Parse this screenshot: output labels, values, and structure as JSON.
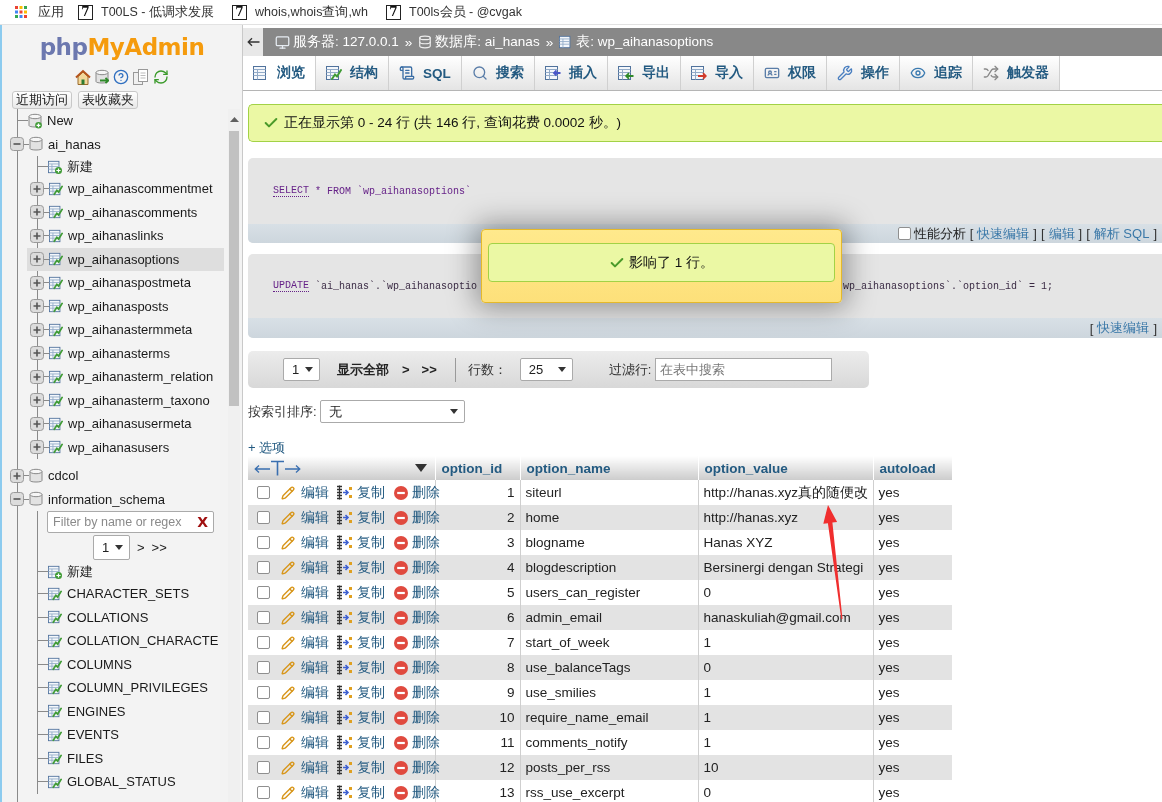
{
  "bookmarks_bar": {
    "apps_label": "应用",
    "bookmarks": [
      {
        "favicon": "7",
        "label": "T00LS - 低调求发展"
      },
      {
        "favicon": "7",
        "label": "whois,whois查询,wh"
      },
      {
        "favicon": "7",
        "label": "T00ls会员 - @cvgak"
      }
    ]
  },
  "sidebar": {
    "logo": {
      "part_1": "php",
      "part_2": "MyAdmin"
    },
    "buttons": [
      "近期访问",
      "表收藏夹"
    ],
    "tree": [
      {
        "kind": "new",
        "label": "New",
        "selected": false
      },
      {
        "kind": "database",
        "label": "ai_hanas",
        "expanded": true,
        "selected": false,
        "children": [
          {
            "kind": "new",
            "label": "新建",
            "selected": false
          },
          {
            "kind": "table",
            "label": "wp_aihanascommentmet",
            "expanded": false,
            "selected": false
          },
          {
            "kind": "table",
            "label": "wp_aihanascomments",
            "expanded": false,
            "selected": false
          },
          {
            "kind": "table",
            "label": "wp_aihanaslinks",
            "expanded": false,
            "selected": false
          },
          {
            "kind": "table",
            "label": "wp_aihanasoptions",
            "expanded": false,
            "selected": true
          },
          {
            "kind": "table",
            "label": "wp_aihanaspostmeta",
            "expanded": false,
            "selected": false
          },
          {
            "kind": "table",
            "label": "wp_aihanasposts",
            "expanded": false,
            "selected": false
          },
          {
            "kind": "table",
            "label": "wp_aihanastermmeta",
            "expanded": false,
            "selected": false
          },
          {
            "kind": "table",
            "label": "wp_aihanasterms",
            "expanded": false,
            "selected": false
          },
          {
            "kind": "table",
            "label": "wp_aihanasterm_relation",
            "expanded": false,
            "selected": false
          },
          {
            "kind": "table",
            "label": "wp_aihanasterm_taxono",
            "expanded": false,
            "selected": false
          },
          {
            "kind": "table",
            "label": "wp_aihanasusermeta",
            "expanded": false,
            "selected": false
          },
          {
            "kind": "table",
            "label": "wp_aihanasusers",
            "expanded": false,
            "selected": false
          }
        ]
      },
      {
        "kind": "database",
        "label": "cdcol",
        "expanded": false,
        "selected": false
      },
      {
        "kind": "database",
        "label": "information_schema",
        "expanded": true,
        "selected": false,
        "filter": {
          "placeholder": "Filter by name or regex",
          "clear_label": "X"
        },
        "pager": {
          "page": "1",
          "links": [
            ">",
            ">>"
          ]
        },
        "children": [
          {
            "kind": "new",
            "label": "新建",
            "selected": false
          },
          {
            "kind": "table",
            "label": "CHARACTER_SETS",
            "selected": false
          },
          {
            "kind": "table",
            "label": "COLLATIONS",
            "selected": false
          },
          {
            "kind": "table",
            "label": "COLLATION_CHARACTE",
            "selected": false
          },
          {
            "kind": "table",
            "label": "COLUMNS",
            "selected": false
          },
          {
            "kind": "table",
            "label": "COLUMN_PRIVILEGES",
            "selected": false
          },
          {
            "kind": "table",
            "label": "ENGINES",
            "selected": false
          },
          {
            "kind": "table",
            "label": "EVENTS",
            "selected": false
          },
          {
            "kind": "table",
            "label": "FILES",
            "selected": false
          },
          {
            "kind": "table",
            "label": "GLOBAL_STATUS",
            "selected": false
          }
        ]
      }
    ]
  },
  "breadcrumb": [
    {
      "label": "服务器: 127.0.0.1",
      "separator": "»"
    },
    {
      "label": "数据库: ai_hanas",
      "separator": "»"
    },
    {
      "label": "表: wp_aihanasoptions"
    }
  ],
  "tabs": [
    {
      "label": "浏览",
      "selected": true
    },
    {
      "label": "结构",
      "selected": false
    },
    {
      "label": "SQL",
      "selected": false
    },
    {
      "label": "搜索",
      "selected": false
    },
    {
      "label": "插入",
      "selected": false
    },
    {
      "label": "导出",
      "selected": false
    },
    {
      "label": "导入",
      "selected": false
    },
    {
      "label": "权限",
      "selected": false
    },
    {
      "label": "操作",
      "selected": false
    },
    {
      "label": "追踪",
      "selected": false
    },
    {
      "label": "触发器",
      "selected": false
    }
  ],
  "success_message": "正在显示第 0 - 24 行 (共 146 行, 查询花费 0.0002 秒。)",
  "queries": [
    {
      "keyword": "SELECT",
      "text": "* FROM `wp_aihanasoptions`",
      "profiling": {
        "label": "性能分析",
        "checked": false
      },
      "links": [
        {
          "open": "[",
          "label": "快速编辑",
          "close": "]"
        },
        {
          "open": "[",
          "label": "编辑",
          "close": "]"
        },
        {
          "open": "[",
          "label": "解析 SQL",
          "close": "]"
        }
      ]
    },
    {
      "keyword": "UPDATE",
      "text": "`ai_hanas`.`wp_aihanasoptio",
      "text_after_popup": "wp_aihanasoptions`.`option_id` = 1;",
      "links": [
        {
          "open": "[",
          "label": "快速编辑",
          "close": "]"
        }
      ]
    }
  ],
  "popup": {
    "message": "影响了 1 行。"
  },
  "pager": {
    "page": "1",
    "show_all": "显示全部",
    "next": ">",
    "last": ">>",
    "rows_label": "行数：",
    "rows_value": "25",
    "filter_label": "过滤行:",
    "filter_placeholder": "在表中搜索"
  },
  "sort": {
    "label": "按索引排序:",
    "value": "无"
  },
  "options_link": "+ 选项",
  "table": {
    "columns": [
      "option_id",
      "option_name",
      "option_value",
      "autoload"
    ],
    "rows": [
      {
        "checked": false,
        "actions": [
          "编辑",
          "复制",
          "删除"
        ],
        "cells": [
          "1",
          "siteurl",
          "http://hanas.xyz真的随便改",
          "yes"
        ]
      },
      {
        "checked": false,
        "actions": [
          "编辑",
          "复制",
          "删除"
        ],
        "cells": [
          "2",
          "home",
          "http://hanas.xyz",
          "yes"
        ]
      },
      {
        "checked": false,
        "actions": [
          "编辑",
          "复制",
          "删除"
        ],
        "cells": [
          "3",
          "blogname",
          "Hanas XYZ",
          "yes"
        ]
      },
      {
        "checked": false,
        "actions": [
          "编辑",
          "复制",
          "删除"
        ],
        "cells": [
          "4",
          "blogdescription",
          "Bersinergi dengan Strategi",
          "yes"
        ]
      },
      {
        "checked": false,
        "actions": [
          "编辑",
          "复制",
          "删除"
        ],
        "cells": [
          "5",
          "users_can_register",
          "0",
          "yes"
        ]
      },
      {
        "checked": false,
        "actions": [
          "编辑",
          "复制",
          "删除"
        ],
        "cells": [
          "6",
          "admin_email",
          "hanaskuliah@gmail.com",
          "yes"
        ]
      },
      {
        "checked": false,
        "actions": [
          "编辑",
          "复制",
          "删除"
        ],
        "cells": [
          "7",
          "start_of_week",
          "1",
          "yes"
        ]
      },
      {
        "checked": false,
        "actions": [
          "编辑",
          "复制",
          "删除"
        ],
        "cells": [
          "8",
          "use_balanceTags",
          "0",
          "yes"
        ]
      },
      {
        "checked": false,
        "actions": [
          "编辑",
          "复制",
          "删除"
        ],
        "cells": [
          "9",
          "use_smilies",
          "1",
          "yes"
        ]
      },
      {
        "checked": false,
        "actions": [
          "编辑",
          "复制",
          "删除"
        ],
        "cells": [
          "10",
          "require_name_email",
          "1",
          "yes"
        ]
      },
      {
        "checked": false,
        "actions": [
          "编辑",
          "复制",
          "删除"
        ],
        "cells": [
          "11",
          "comments_notify",
          "1",
          "yes"
        ]
      },
      {
        "checked": false,
        "actions": [
          "编辑",
          "复制",
          "删除"
        ],
        "cells": [
          "12",
          "posts_per_rss",
          "10",
          "yes"
        ]
      },
      {
        "checked": false,
        "actions": [
          "编辑",
          "复制",
          "删除"
        ],
        "cells": [
          "13",
          "rss_use_excerpt",
          "0",
          "yes"
        ]
      }
    ]
  }
}
